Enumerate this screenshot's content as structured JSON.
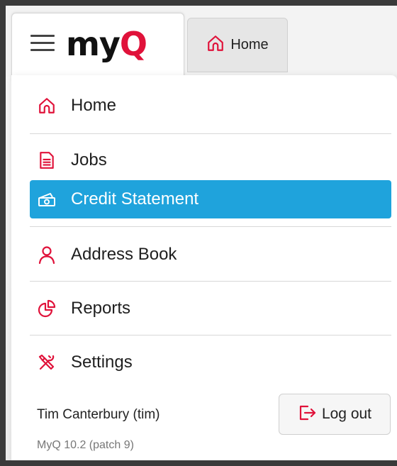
{
  "brand": {
    "logo_text_main": "my",
    "logo_text_accent": "Q",
    "accent_color": "#e0123a"
  },
  "tabs": [
    {
      "label": "Home",
      "icon": "home-icon"
    }
  ],
  "menu": {
    "items": [
      {
        "label": "Home",
        "icon": "home-icon",
        "active": false
      },
      {
        "label": "Jobs",
        "icon": "document-icon",
        "active": false
      },
      {
        "label": "Credit Statement",
        "icon": "money-icon",
        "active": true
      },
      {
        "label": "Address Book",
        "icon": "person-icon",
        "active": false
      },
      {
        "label": "Reports",
        "icon": "pie-chart-icon",
        "active": false
      },
      {
        "label": "Settings",
        "icon": "tools-icon",
        "active": false
      }
    ],
    "active_color": "#1fa3dc"
  },
  "user": {
    "display_name": "Tim Canterbury (tim)",
    "version": "MyQ 10.2 (patch 9)"
  },
  "logout": {
    "label": "Log out",
    "icon": "logout-icon"
  }
}
